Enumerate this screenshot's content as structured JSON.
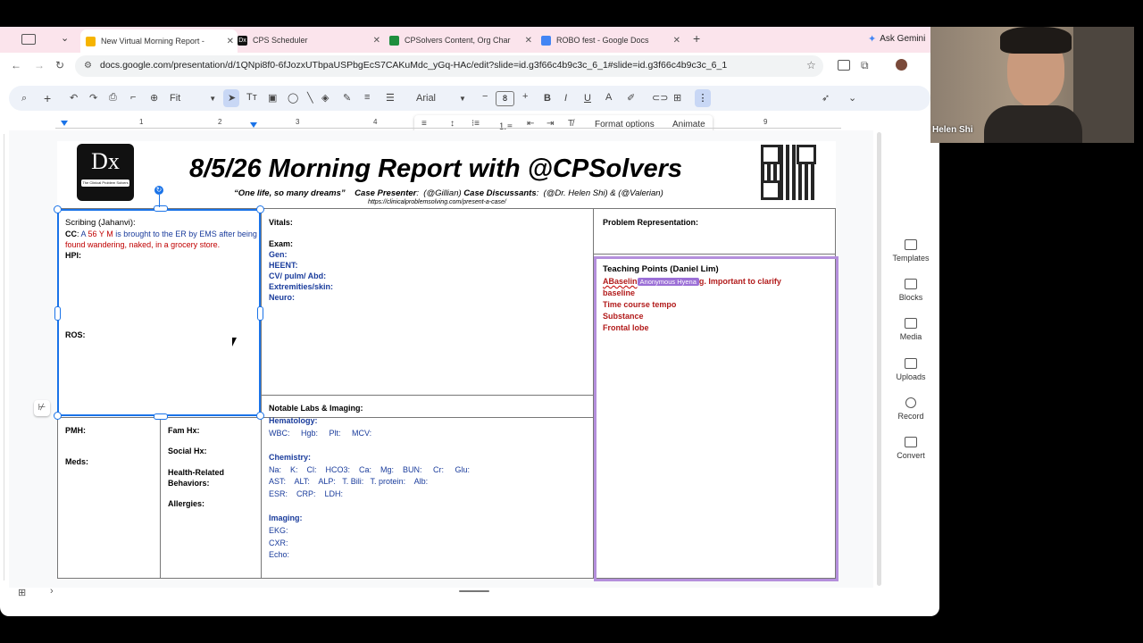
{
  "browser": {
    "tabs": [
      {
        "label": "New Virtual Morning Report -",
        "active": true
      },
      {
        "label": "CPS Scheduler",
        "active": false
      },
      {
        "label": "CPSolvers Content, Org Char",
        "active": false
      },
      {
        "label": "ROBO fest - Google Docs",
        "active": false
      }
    ],
    "ask_gemini": "Ask Gemini",
    "url": "docs.google.com/presentation/d/1QNpi8f0-6fJozxUTbpaUSPbgEcS7CAKuMdc_yGq-HAc/edit?slide=id.g3f66c4b9c3c_6_1#slide=id.g3f66c4b9c3c_6_1"
  },
  "toolbar": {
    "zoom": "Fit",
    "font": "Arial",
    "font_size": "8"
  },
  "context_toolbar": {
    "format_options": "Format options",
    "animate": "Animate"
  },
  "ruler": {
    "marks": [
      "1",
      "2",
      "3",
      "4",
      "9"
    ]
  },
  "slide": {
    "logo_text": "Dx",
    "logo_subtext": "The Clinical Problem Solvers",
    "title": "8/5/26 Morning Report with @CPSolvers",
    "subtitle_quote": "“One life, so many dreams”",
    "case_presenter_label": "Case Presenter",
    "case_presenter": "(@Gillian)",
    "case_discussants_label": "Case Discussants",
    "case_discussants": "(@Dr. Helen Shi) & (@Valerian)",
    "url": "https://clinicalproblemsolving.com/present-a-case/",
    "scribing": "Scribing (Jahanvi):",
    "cc_label": "CC",
    "cc_line1_a": "A",
    "cc_line1_b": "56 Y M",
    "cc_line1_c": "is brought to the ER by EMS after being",
    "cc_line2": "found wandering, naked, in a grocery store.",
    "hpi": "HPI",
    "ros": "ROS",
    "vitals": "Vitals",
    "exam": "Exam",
    "gen": "Gen",
    "heent": "HEENT",
    "cv": "CV/ pulm/ Abd",
    "ext": "Extremities/skin",
    "neuro": "Neuro",
    "problem_rep": "Problem Representation:",
    "teaching_title": "Teaching Points (Daniel Lim)",
    "tp_line1_a": "ABaselin",
    "tp_cursor_label": "Anonymous Hyena",
    "tp_line1_b": "g. Important to clarify",
    "tp_line2": "baseline",
    "tp_items": [
      "Time course tempo",
      "Substance",
      "Frontal lobe"
    ],
    "pmh": "PMH",
    "meds": "Meds",
    "fam": "Fam Hx",
    "social": "Social Hx",
    "health_l1": "Health-Related",
    "health_l2": "Behaviors",
    "allergies": "Allergies",
    "labs_title": "Notable Labs & Imaging",
    "hematology": "Hematology",
    "hem_row": "WBC:     Hgb:     Plt:     MCV:",
    "chemistry": "Chemistry",
    "chem_row1": "Na:    K:    Cl:    HCO3:    Ca:    Mg:    BUN:     Cr:     Glu:",
    "chem_row2": "AST:    ALT:    ALP:   T. Bili:   T. protein:    Alb:",
    "chem_row3": "ESR:    CRP:    LDH:",
    "imaging": "Imaging",
    "ekg": "EKG:",
    "cxr": "CXR:",
    "echo": "Echo:"
  },
  "side_panel": [
    "Templates",
    "Blocks",
    "Media",
    "Uploads",
    "Record",
    "Convert"
  ],
  "video": {
    "name": "Helen Shi"
  },
  "colors": {
    "tab_bar": "#fbe4ec",
    "selection": "#1a73e8",
    "teaching_border": "#b48fdc",
    "red": "#c00000",
    "blue": "#1a3c9c"
  }
}
